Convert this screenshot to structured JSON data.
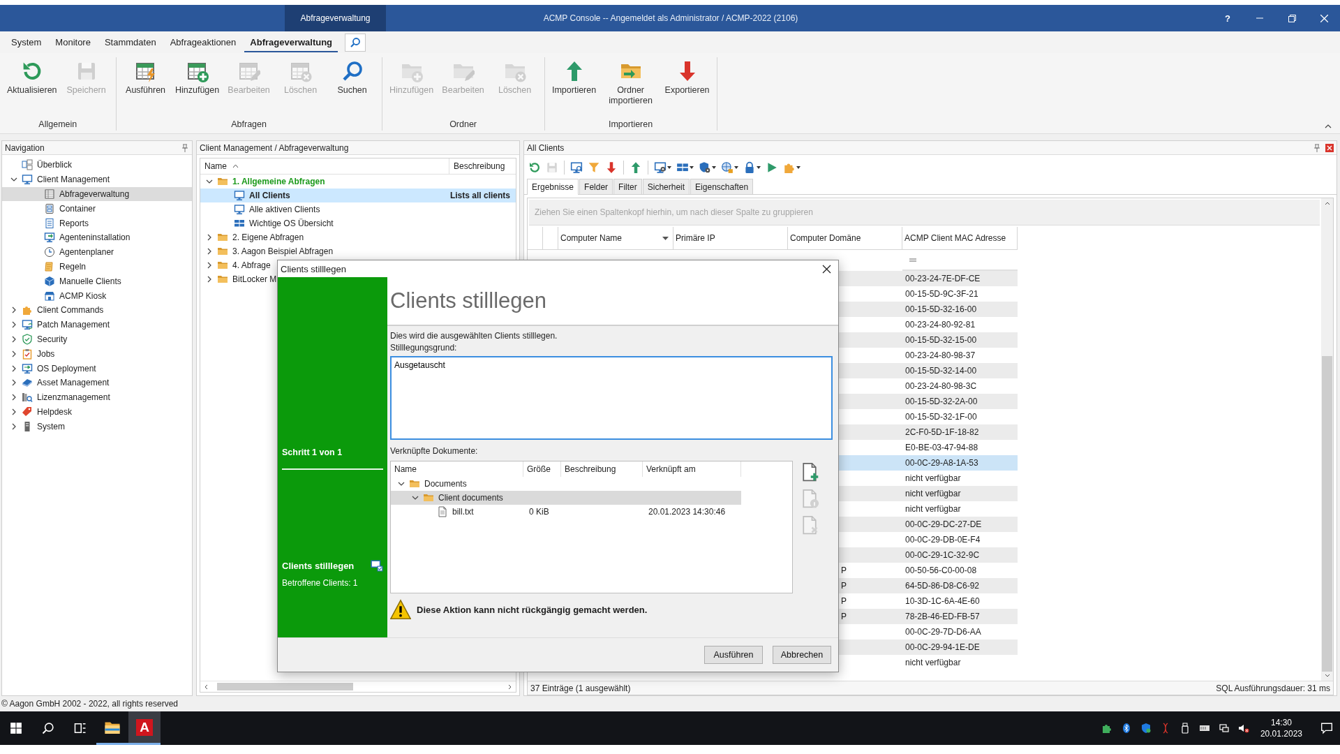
{
  "window": {
    "contextual_tab": "Abfrageverwaltung",
    "title": "ACMP Console -- Angemeldet als Administrator / ACMP-2022 (2106)",
    "help": "?"
  },
  "menu": [
    {
      "label": "System",
      "selected": false
    },
    {
      "label": "Monitore",
      "selected": false
    },
    {
      "label": "Stammdaten",
      "selected": false
    },
    {
      "label": "Abfrageaktionen",
      "selected": false
    },
    {
      "label": "Abfrageverwaltung",
      "selected": true
    }
  ],
  "ribbon": [
    {
      "group": "Allgemein",
      "buttons": [
        {
          "label": "Aktualisieren",
          "disabled": false
        },
        {
          "label": "Speichern",
          "disabled": true
        }
      ]
    },
    {
      "group": "Abfragen",
      "buttons": [
        {
          "label": "Ausführen",
          "disabled": false
        },
        {
          "label": "Hinzufügen",
          "disabled": false
        },
        {
          "label": "Bearbeiten",
          "disabled": true
        },
        {
          "label": "Löschen",
          "disabled": true
        },
        {
          "label": "Suchen",
          "disabled": false
        }
      ]
    },
    {
      "group": "Ordner",
      "buttons": [
        {
          "label": "Hinzufügen",
          "disabled": true
        },
        {
          "label": "Bearbeiten",
          "disabled": true
        },
        {
          "label": "Löschen",
          "disabled": true
        }
      ]
    },
    {
      "group": "Importieren",
      "buttons": [
        {
          "label": "Importieren",
          "disabled": false
        },
        {
          "label": "Ordner importieren",
          "disabled": false
        },
        {
          "label": "Exportieren",
          "disabled": false
        }
      ]
    }
  ],
  "navigation": {
    "title": "Navigation",
    "items": [
      {
        "label": "Überblick",
        "selected": false
      },
      {
        "label": "Client Management",
        "expanded": true,
        "selected": false,
        "children": [
          {
            "label": "Abfrageverwaltung",
            "selected": true
          },
          {
            "label": "Container",
            "selected": false
          },
          {
            "label": "Reports",
            "selected": false
          },
          {
            "label": "Agenteninstallation",
            "selected": false
          },
          {
            "label": "Agentenplaner",
            "selected": false
          },
          {
            "label": "Regeln",
            "selected": false
          },
          {
            "label": "Manuelle Clients",
            "selected": false
          },
          {
            "label": "ACMP Kiosk",
            "selected": false
          }
        ]
      },
      {
        "label": "Client Commands",
        "expanded": false,
        "selected": false
      },
      {
        "label": "Patch Management",
        "expanded": false,
        "selected": false
      },
      {
        "label": "Security",
        "expanded": false,
        "selected": false
      },
      {
        "label": "Jobs",
        "expanded": false,
        "selected": false
      },
      {
        "label": "OS Deployment",
        "expanded": false,
        "selected": false
      },
      {
        "label": "Asset Management",
        "expanded": false,
        "selected": false
      },
      {
        "label": "Lizenzmanagement",
        "expanded": false,
        "selected": false
      },
      {
        "label": "Helpdesk",
        "expanded": false,
        "selected": false
      },
      {
        "label": "System",
        "expanded": false,
        "selected": false
      }
    ]
  },
  "query_panel": {
    "breadcrumb": "Client Management / Abfrageverwaltung",
    "columns": [
      "Name",
      "Beschreibung"
    ],
    "tree": [
      {
        "label": "1. Allgemeine Abfragen",
        "highlighted": true,
        "expanded": true,
        "children": [
          {
            "label": "All Clients",
            "description": "Lists all clients",
            "selected": true
          },
          {
            "label": "Alle aktiven Clients",
            "selected": false
          },
          {
            "label": "Wichtige OS Übersicht",
            "selected": false
          }
        ]
      },
      {
        "label": "2. Eigene Abfragen",
        "highlighted": false,
        "expanded": false
      },
      {
        "label": "3. Aagon Beispiel Abfragen",
        "highlighted": false,
        "expanded": false
      },
      {
        "label": "4. Abfrage",
        "highlighted": false,
        "expanded": false
      },
      {
        "label": "BitLocker M",
        "highlighted": false,
        "expanded": false
      }
    ]
  },
  "results_panel": {
    "title": "All Clients",
    "toolbar": [
      [
        {
          "disabled": false,
          "dropdown": false
        },
        {
          "disabled": true,
          "dropdown": false
        }
      ],
      [
        {
          "disabled": false,
          "dropdown": false
        },
        {
          "disabled": false,
          "dropdown": false
        },
        {
          "disabled": false,
          "dropdown": false
        }
      ],
      [
        {
          "disabled": false,
          "dropdown": false
        }
      ],
      [
        {
          "disabled": false,
          "dropdown": true
        },
        {
          "disabled": false,
          "dropdown": true
        },
        {
          "disabled": false,
          "dropdown": true
        },
        {
          "disabled": false,
          "dropdown": true
        },
        {
          "disabled": false,
          "dropdown": true
        },
        {
          "disabled": false,
          "dropdown": false
        },
        {
          "disabled": false,
          "dropdown": true
        }
      ]
    ],
    "tabs": [
      {
        "label": "Ergebnisse",
        "selected": true
      },
      {
        "label": "Felder",
        "selected": false
      },
      {
        "label": "Filter",
        "selected": false
      },
      {
        "label": "Sicherheit",
        "selected": false
      },
      {
        "label": "Eigenschaften",
        "selected": false
      }
    ],
    "group_hint": "Ziehen Sie einen Spaltenkopf hierhin, um nach dieser Spalte zu gruppieren",
    "columns": [
      "Computer Name",
      "Primäre IP",
      "Computer Domäne",
      "ACMP Client MAC Adresse"
    ],
    "rows": [
      {
        "mac": "00-23-24-7E-DF-CE",
        "selected": false
      },
      {
        "mac": "00-15-5D-9C-3F-21",
        "selected": false
      },
      {
        "mac": "00-15-5D-32-16-00",
        "selected": false
      },
      {
        "mac": "00-23-24-80-92-81",
        "selected": false
      },
      {
        "mac": "00-15-5D-32-15-00",
        "selected": false
      },
      {
        "mac": "00-23-24-80-98-37",
        "selected": false
      },
      {
        "mac": "00-15-5D-32-14-00",
        "selected": false
      },
      {
        "mac": "00-23-24-80-98-3C",
        "selected": false
      },
      {
        "mac": "00-15-5D-32-2A-00",
        "selected": false
      },
      {
        "mac": "00-15-5D-32-1F-00",
        "selected": false
      },
      {
        "mac": "2C-F0-5D-1F-18-82",
        "selected": false
      },
      {
        "mac": "E0-BE-03-47-94-88",
        "selected": false
      },
      {
        "mac": "00-0C-29-A8-1A-53",
        "selected": true
      },
      {
        "mac": "nicht verfügbar",
        "selected": false
      },
      {
        "mac": "nicht verfügbar",
        "selected": false
      },
      {
        "mac": "nicht verfügbar",
        "selected": false
      },
      {
        "mac": "00-0C-29-DC-27-DE",
        "selected": false
      },
      {
        "mac": "00-0C-29-DB-0E-F4",
        "selected": false
      },
      {
        "mac": "00-0C-29-1C-32-9C",
        "selected": false
      },
      {
        "domain": "P",
        "mac": "00-50-56-C0-00-08",
        "selected": false
      },
      {
        "domain": "P",
        "mac": "64-5D-86-D8-C6-92",
        "selected": false
      },
      {
        "domain": "P",
        "mac": "10-3D-1C-6A-4E-60",
        "selected": false
      },
      {
        "domain": "P",
        "mac": "78-2B-46-ED-FB-57",
        "selected": false
      },
      {
        "mac": "00-0C-29-7D-D6-AA",
        "selected": false
      },
      {
        "mac": "00-0C-29-94-1E-DE",
        "selected": false
      },
      {
        "mac": "nicht verfügbar",
        "selected": false
      }
    ],
    "status": "37 Einträge (1 ausgewählt)",
    "duration": "SQL Ausführungsdauer: 31 ms"
  },
  "dialog": {
    "title": "Clients stilllegen",
    "step": "Schritt 1 von 1",
    "action": "Clients stilllegen",
    "affected": "Betroffene Clients: 1",
    "heading": "Clients stilllegen",
    "intro": "Dies wird die ausgewählten Clients stilllegen.",
    "reason_label": "Stilllegungsgrund:",
    "reason_value": "Ausgetauscht",
    "documents_label": "Verknüpfte Dokumente:",
    "document_columns": [
      "Name",
      "Größe",
      "Beschreibung",
      "Verknüpft am"
    ],
    "documents": [
      {
        "kind": "folder",
        "name": "Documents",
        "expanded": true,
        "selected": false,
        "children": [
          {
            "kind": "folder",
            "name": "Client documents",
            "expanded": true,
            "selected": true,
            "children": [
              {
                "kind": "file",
                "name": "bill.txt",
                "size": "0 KiB",
                "linked": "20.01.2023 14:30:46",
                "selected": false
              }
            ]
          }
        ]
      }
    ],
    "document_actions": [
      {
        "disabled": false
      },
      {
        "disabled": true
      },
      {
        "disabled": true
      }
    ],
    "warning": "Diese Aktion kann nicht rückgängig gemacht werden.",
    "buttons": [
      "Ausführen",
      "Abbrechen"
    ]
  },
  "footer": "© Aagon GmbH 2002 - 2022, all rights reserved",
  "taskbar": {
    "apps": [
      {
        "kind": "explorer",
        "selected": false
      },
      {
        "kind": "acmp",
        "label": "A",
        "selected": true
      }
    ],
    "time": "14:30",
    "date": "20.01.2023"
  }
}
